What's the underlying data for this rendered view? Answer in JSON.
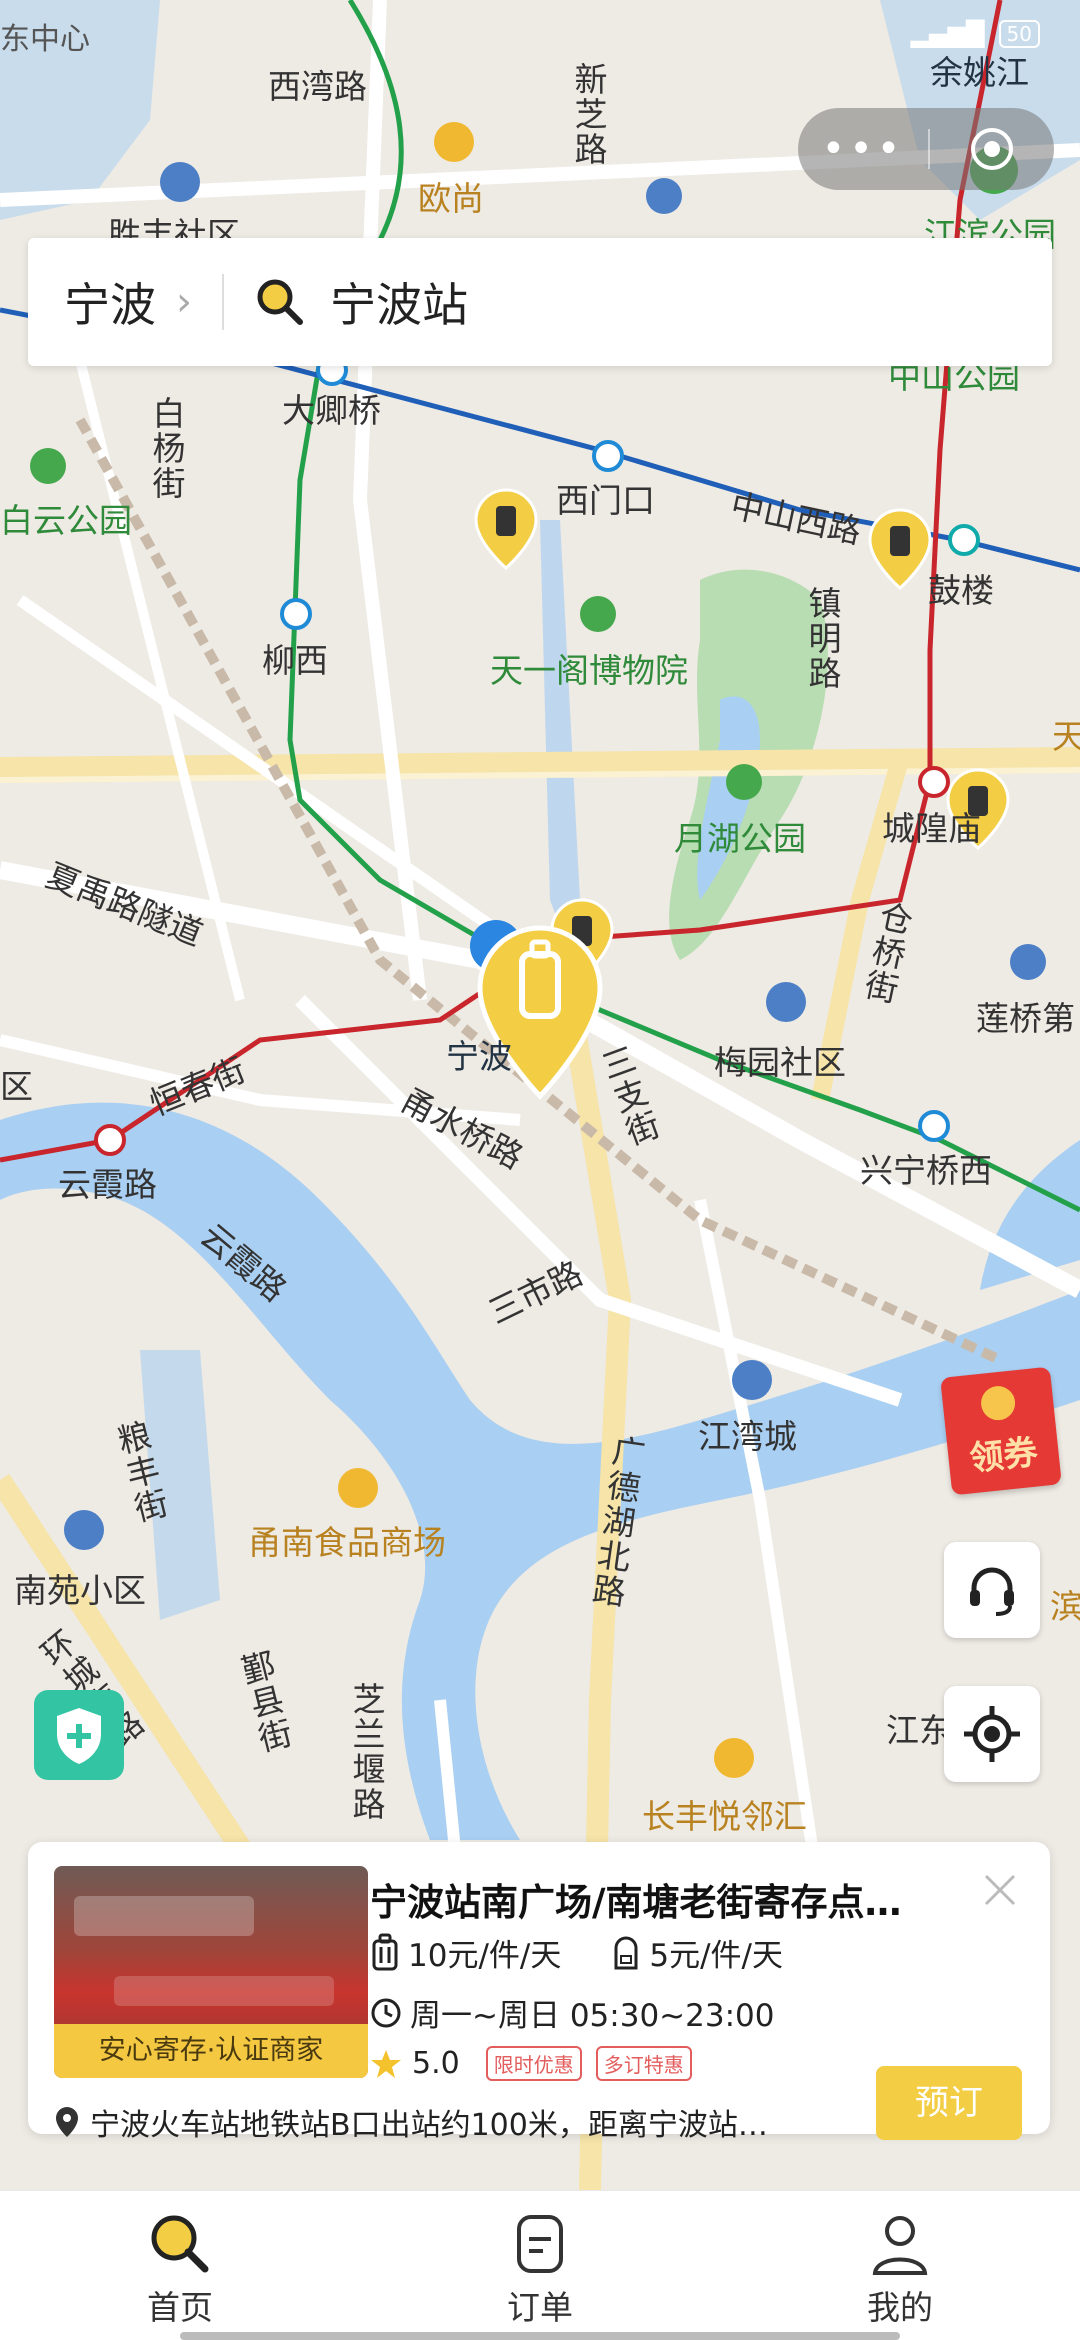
{
  "status_bar": {
    "left_text": "东中心",
    "battery": "50"
  },
  "capsule": {
    "more_label": "•••"
  },
  "search": {
    "city": "宁波",
    "query": "宁波站"
  },
  "map": {
    "labels": [
      {
        "text": "西湾路",
        "style": "dark"
      },
      {
        "text": "余姚江",
        "style": "blue"
      },
      {
        "text": "新芝路",
        "style": "dark"
      },
      {
        "text": "欧尚",
        "style": "orange"
      },
      {
        "text": "胜丰社区",
        "style": "dark"
      },
      {
        "text": "江滨公园",
        "style": "green"
      },
      {
        "text": "中山公园",
        "style": "green"
      },
      {
        "text": "大卿桥",
        "style": "dark"
      },
      {
        "text": "白杨街",
        "style": "dark"
      },
      {
        "text": "西门口",
        "style": "dark"
      },
      {
        "text": "中山西路",
        "style": "dark"
      },
      {
        "text": "鼓楼",
        "style": "dark"
      },
      {
        "text": "白云公园",
        "style": "green"
      },
      {
        "text": "柳西",
        "style": "dark"
      },
      {
        "text": "天一阁博物院",
        "style": "green"
      },
      {
        "text": "镇明路",
        "style": "dark"
      },
      {
        "text": "月湖公园",
        "style": "green"
      },
      {
        "text": "城隍庙",
        "style": "dark"
      },
      {
        "text": "夏禹路隧道",
        "style": "dark"
      },
      {
        "text": "仓桥街",
        "style": "dark"
      },
      {
        "text": "莲桥第",
        "style": "dark"
      },
      {
        "text": "宁波",
        "style": "blue"
      },
      {
        "text": "梅园社区",
        "style": "dark"
      },
      {
        "text": "恒春街",
        "style": "dark"
      },
      {
        "text": "甬水桥路",
        "style": "dark"
      },
      {
        "text": "三支街",
        "style": "dark"
      },
      {
        "text": "云霞路",
        "style": "dark"
      },
      {
        "text": "兴宁桥西",
        "style": "dark"
      },
      {
        "text": "云霞路",
        "style": "dark"
      },
      {
        "text": "三市路",
        "style": "dark"
      },
      {
        "text": "江湾城",
        "style": "dark"
      },
      {
        "text": "粮丰街",
        "style": "dark"
      },
      {
        "text": "广德湖北路",
        "style": "dark"
      },
      {
        "text": "甬南食品商场",
        "style": "orange"
      },
      {
        "text": "南苑小区",
        "style": "dark"
      },
      {
        "text": "环城南路",
        "style": "dark"
      },
      {
        "text": "鄞县街",
        "style": "dark"
      },
      {
        "text": "芝兰堰路",
        "style": "dark"
      },
      {
        "text": "江东府",
        "style": "dark"
      },
      {
        "text": "长丰悦邻汇",
        "style": "orange"
      },
      {
        "text": "天",
        "style": "orange"
      },
      {
        "text": "滨",
        "style": "orange"
      },
      {
        "text": "区",
        "style": "dark"
      }
    ]
  },
  "coupon": {
    "label": "领券"
  },
  "card": {
    "title": "宁波站南广场/南塘老街寄存点…",
    "badge": "安心寄存·认证商家",
    "price_large": "10元/件/天",
    "price_small": "5元/件/天",
    "hours": "周一~周日 05:30~23:00",
    "rating": "5.0",
    "tags": [
      "限时优惠",
      "多订特惠"
    ],
    "address": "宁波火车站地铁站B口出站约100米，距离宁波站…",
    "book_label": "预订"
  },
  "tabs": [
    {
      "label": "首页",
      "icon": "search-icon"
    },
    {
      "label": "订单",
      "icon": "order-icon"
    },
    {
      "label": "我的",
      "icon": "profile-icon"
    }
  ],
  "colors": {
    "accent": "#F3CD43",
    "metro_green": "#23A04A",
    "metro_red": "#C8262C",
    "metro_blue": "#1F5FB8",
    "water": "#A9CFF2",
    "park": "#B8DDB2"
  }
}
